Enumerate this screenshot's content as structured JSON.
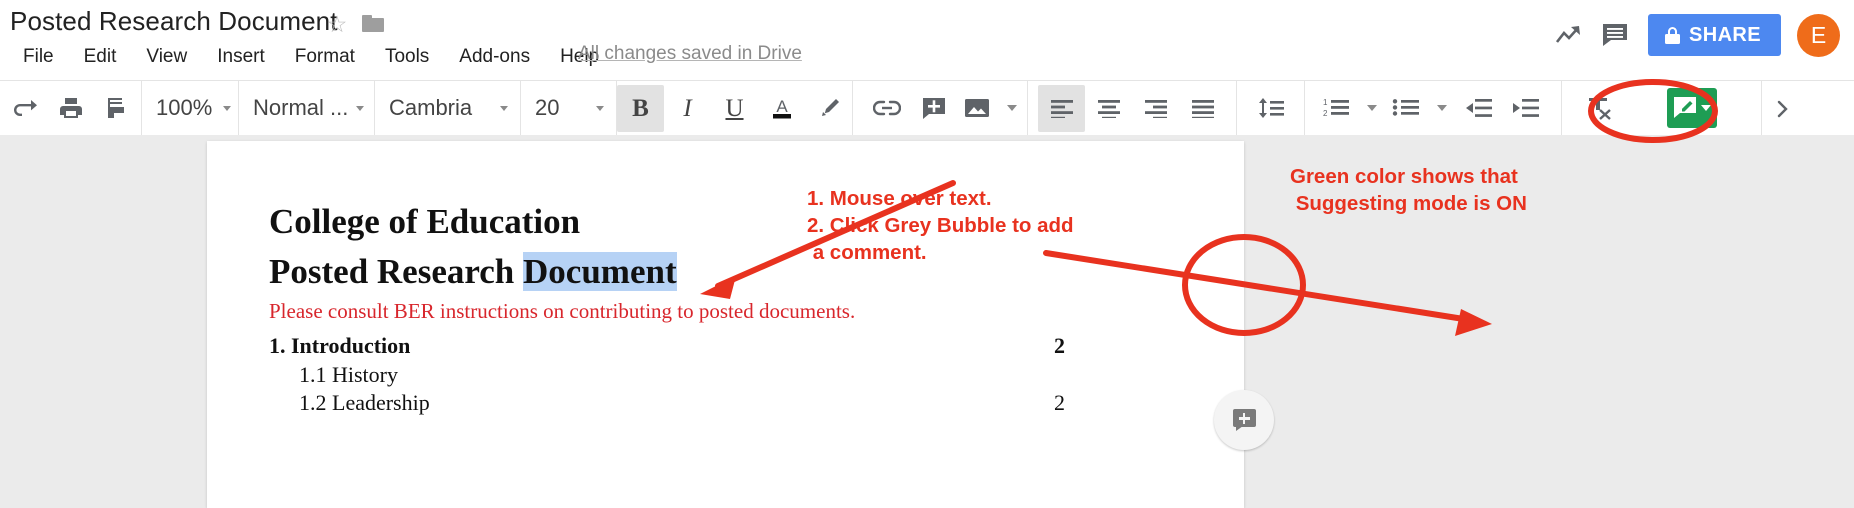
{
  "header": {
    "doc_title": "Posted Research Document",
    "star_icon": "star-outline-icon",
    "folder_icon": "folder-icon",
    "menu_items": [
      {
        "label": "File"
      },
      {
        "label": "Edit"
      },
      {
        "label": "View"
      },
      {
        "label": "Insert"
      },
      {
        "label": "Format"
      },
      {
        "label": "Tools"
      },
      {
        "label": "Add-ons"
      },
      {
        "label": "Help"
      }
    ],
    "save_status": "All changes saved in Drive",
    "trend_icon": "trending-up-icon",
    "comment_icon": "comment-icon",
    "share_label": "SHARE",
    "share_lock_icon": "lock-icon",
    "avatar_initial": "E",
    "avatar_color": "#ef6c1a",
    "share_color": "#4d88f0"
  },
  "toolbar": {
    "redo_icon": "redo-icon",
    "print_icon": "print-icon",
    "paint_format_icon": "paint-format-icon",
    "zoom_value": "100%",
    "style_value": "Normal ...",
    "font_value": "Cambria",
    "size_value": "20",
    "bold_label": "B",
    "italic_label": "I",
    "underline_label": "U",
    "text_color_label": "A",
    "highlight_icon": "highlight-pen-icon",
    "link_icon": "insert-link-icon",
    "add_comment_icon": "add-comment-icon",
    "image_icon": "insert-image-icon",
    "align_left_icon": "align-left-icon",
    "align_center_icon": "align-center-icon",
    "align_right_icon": "align-right-icon",
    "align_justify_icon": "align-justify-icon",
    "line_spacing_icon": "line-spacing-icon",
    "numbered_list_icon": "numbered-list-icon",
    "bulleted_list_icon": "bulleted-list-icon",
    "indent_decrease_icon": "indent-decrease-icon",
    "indent_increase_icon": "indent-increase-icon",
    "clear_formatting_icon": "clear-formatting-icon",
    "suggesting_mode_icon": "suggesting-mode-pencil-icon",
    "suggesting_mode_color": "#1e9d54",
    "more_icon": "more-options-icon"
  },
  "document": {
    "heading_1": "College of Education",
    "heading_2_plain": "Posted Research ",
    "heading_2_highlighted": "Document",
    "highlight_color": "#b6d2f5",
    "note": "Please consult BER instructions on contributing to posted documents.",
    "note_color": "#d8262c",
    "toc": [
      {
        "label": "1. Introduction",
        "page": "2"
      },
      {
        "label": "1.1 History",
        "page": ""
      },
      {
        "label": "1.2 Leadership",
        "page": "2"
      }
    ],
    "comment_bubble_icon": "add-comment-bubble-icon"
  },
  "annotations": {
    "color": "#e8321f",
    "steps_text": "1. Mouse over text.\n2. Click Grey Bubble to add\n a comment.",
    "green_text": "Green color shows that\n Suggesting mode is ON",
    "arrow_to_text": "arrow-pointing-to-highlighted-text",
    "arrow_to_bubble": "arrow-pointing-to-comment-bubble",
    "ellipse_toolbar": "ellipse-around-suggesting-mode-button",
    "ellipse_bubble": "ellipse-around-comment-bubble"
  }
}
